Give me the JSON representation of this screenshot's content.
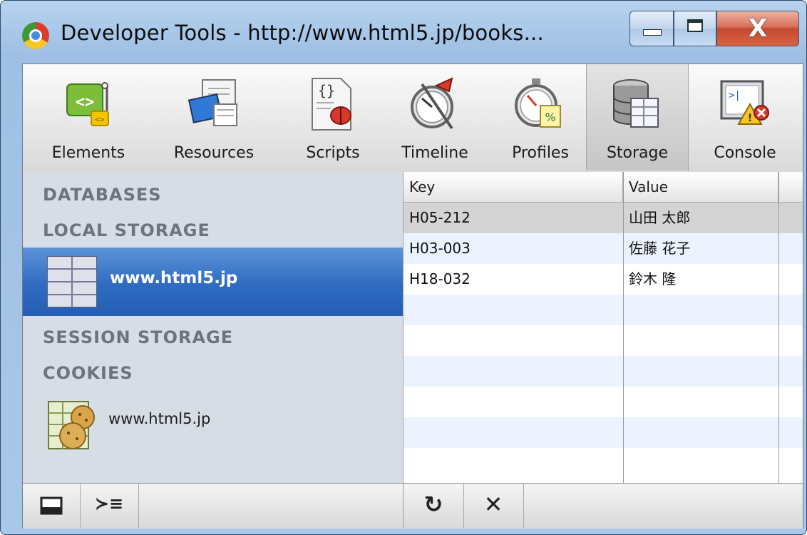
{
  "window": {
    "title": "Developer Tools - http://www.html5.jp/books...",
    "icon": "chrome-icon",
    "controls": [
      "minimize-icon",
      "maximize-icon",
      "close-icon"
    ],
    "close_glyph": "X"
  },
  "toolbar": {
    "items": [
      {
        "label": "Elements",
        "icon": "elements-icon"
      },
      {
        "label": "Resources",
        "icon": "resources-icon"
      },
      {
        "label": "Scripts",
        "icon": "scripts-icon"
      },
      {
        "label": "Timeline",
        "icon": "timeline-icon"
      },
      {
        "label": "Profiles",
        "icon": "profiles-icon"
      },
      {
        "label": "Storage",
        "icon": "storage-icon",
        "selected": true
      },
      {
        "label": "Console",
        "icon": "console-icon"
      }
    ]
  },
  "sidebar": {
    "databases": "DATABASES",
    "local_storage": "LOCAL STORAGE",
    "local_item": "www.html5.jp",
    "session_storage": "SESSION STORAGE",
    "cookies": "COOKIES",
    "cookie_item": "www.html5.jp"
  },
  "grid": {
    "columns": [
      "Key",
      "Value"
    ],
    "rows": [
      {
        "key": "H05-212",
        "value": "山田 太郎",
        "selected": true
      },
      {
        "key": "H03-003",
        "value": "佐藤 花子"
      },
      {
        "key": "H18-032",
        "value": "鈴木 隆"
      }
    ]
  },
  "statusbar": {
    "left_buttons": [
      "dock-icon",
      "console-toggle-icon"
    ],
    "right_buttons": [
      "refresh-icon",
      "delete-icon"
    ],
    "console_glyph": "≻≡",
    "refresh_glyph": "↻",
    "delete_glyph": "✕"
  },
  "colors": {
    "selection": "#2f6bc1",
    "row_stripe": "#edf3fe",
    "selected_row": "#d4d4d4"
  }
}
